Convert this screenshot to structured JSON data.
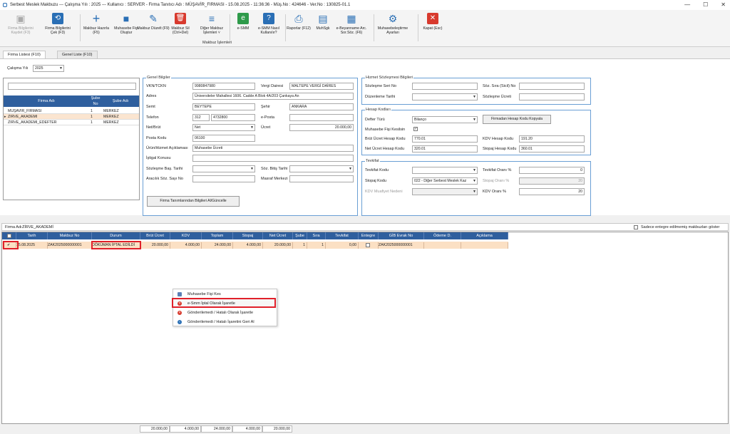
{
  "window": {
    "title": "Serbest Meslek Makbuzu  ---  Çalışma Yılı : 2025  ---  Kullanıcı : SERVER - Firma Tanıtıcı Adı : MÜŞAVİR_FIRMASI  -  15.08.2025 - 11:36:36  -  Müş.No : 424646  - Ver.No : 130825-01.1"
  },
  "toolbar": {
    "b1": "Firma Bilgilerini Kaydet (F3)",
    "b2": "Firma Bilgilerini Çek (F3)",
    "b3": "Makbuz Hazırla (F5)",
    "b4": "Muhasebe Fişi Oluştur",
    "b5": "Makbuz Düzelt (F9)",
    "b6": "Makbuz Sil (Ctrl+Del)",
    "b7": "Diğer Makbuz İşlemleri",
    "b8": "e-SMM",
    "b9": "e-SMM Nasıl Kullanılır?",
    "b10": "Raporlar (F12)",
    "b11": "MuhSgk",
    "b12": "e-Beyanname Arc. Sor.Söz. (F6)",
    "b13": "Muhasebeleştirme Ayarları",
    "b14": "Kapat (Esc)",
    "group": "Makbuz İşlemleri"
  },
  "tabs": {
    "t1": "Firma Listesi (F10)",
    "t2": "Genel Liste (F10)"
  },
  "year": {
    "label": "Çalışma Yılı",
    "value": "2025"
  },
  "firmgrid": {
    "h1": "Firma Adı",
    "h2": "Şube No",
    "h3": "Şube Adı",
    "rows": [
      {
        "name": "MÜŞAVİR_FIRMASI",
        "no": "1",
        "sube": "MERKEZ"
      },
      {
        "name": "ZİRVE_AKADEMİ",
        "no": "1",
        "sube": "MERKEZ"
      },
      {
        "name": "ZİRVE_AKADEMİ_EDEFTER",
        "no": "1",
        "sube": "MERKEZ"
      }
    ]
  },
  "genel": {
    "title": "Genel Bilgiler",
    "vkn_l": "VKN/TCKN",
    "vkn": "9980847980",
    "vd_l": "Vergi Dairesi",
    "vd": "MALTEPE VERGİ DAİRES",
    "adres_l": "Adres",
    "adres": "Üniversiteler Mahallesi 1606. Cadde A Blok 4A/203 Çankaya An",
    "semt_l": "Semt",
    "semt": "BEYTEPE",
    "sehir_l": "Şehir",
    "sehir": "ANKARA",
    "tel_l": "Telefon",
    "tel1": "312",
    "tel2": "4732800",
    "eposta_l": "e-Posta",
    "net_l": "Net/Brüt",
    "net": "Net",
    "ucret_l": "Ücret",
    "ucret": "20.000,00",
    "pk_l": "Posta Kodu",
    "pk": "06100",
    "urun_l": "Ürün/Hizmet Açıklaması",
    "urun": "Muhasebe Ücreti",
    "istigal_l": "İştigal Konusu",
    "sbas_l": "Sözleşme Baş. Tarihi",
    "sbit_l": "Söz. Bitiş Tarihi",
    "aracilik_l": "Aracılık Söz. Sayı No",
    "masraf_l": "Masraf Merkezi",
    "button": "Firma Tanımlarından Bilgileri Al/Güncelle"
  },
  "hizmet": {
    "title": "Hizmet Sözleşmesi Bilgileri",
    "seri_l": "Sözleşme Seri No",
    "sira_l": "Söz. Sıra (Sicil) No",
    "duz_l": "Düzenleme Tarihi",
    "ucret_l": "Sözleşme Ücreti"
  },
  "hesap": {
    "title": "Hesap Kodları",
    "defter_l": "Defter Türü",
    "defter": "Bilanço",
    "kopyala": "Firmadan Hesap Kodu Kopyala",
    "fis_l": "Muhasebe Fişi Kesilsin",
    "brut_l": "Brüt Ücret Hesap Kodu",
    "brut": "770.01",
    "kdv_l": "KDV Hesap Kodu",
    "kdv": "191.20",
    "netk_l": "Net Ücret Hesap Kodu",
    "netk": "320.01",
    "stopajk_l": "Stopaj Hesap Kodu",
    "stopajk": "360.01"
  },
  "tevkifat": {
    "title": "Tevkifat",
    "kod_l": "Tevkifat Kodu",
    "oran_l": "Tevkifat Oranı %",
    "oran": "0",
    "stopaj_l": "Stopaj Kodu",
    "stopaj": "022 - Diğer Serbest Meslek Kaz",
    "soran_l": "Stopaj Oranı %",
    "soran": "20",
    "muaf_l": "KDV Muafiyet Nedeni",
    "kdvoran_l": "KDV Oranı %",
    "kdvoran": "20"
  },
  "firmabar": {
    "label": "Firma Adı :",
    "value": "ZİRVE_AKADEMİ",
    "check": "Sadece entegre edilmemiş makbuzları göster"
  },
  "mgrid": {
    "headers": [
      "Tarih",
      "Makbuz No",
      "Durum",
      "Brüt Ücret",
      "KDV",
      "Toplam",
      "Stopaj",
      "Net Ücret",
      "Şube",
      "Sıra",
      "Tevkifat",
      "Entegre",
      "GİB Evrak No",
      "Ödeme D.",
      "Açıklama"
    ],
    "row": [
      "15.08.2025",
      "ZAK2025000000001",
      "DÖKÜMAN İPTAL EDİLDİ",
      "20.000,00",
      "4.000,00",
      "24.000,00",
      "4.000,00",
      "20.000,00",
      "1",
      "1",
      "0,00",
      "",
      "ZAK2025000000001",
      "",
      ""
    ]
  },
  "ctx": {
    "i1": "Muhasebe Fişi Kes",
    "i2": "e-Smm İptal Olarak İşaretle",
    "i3": "Gönderilemedi / Hatalı Olarak İşaretle",
    "i4": "Gönderilemedi / Hatalı İşaretini Geri Al"
  },
  "totals": {
    "brut": "20.000,00",
    "kdv": "4.000,00",
    "toplam": "24.000,00",
    "stopaj": "4.000,00",
    "net": "20.000,00"
  }
}
